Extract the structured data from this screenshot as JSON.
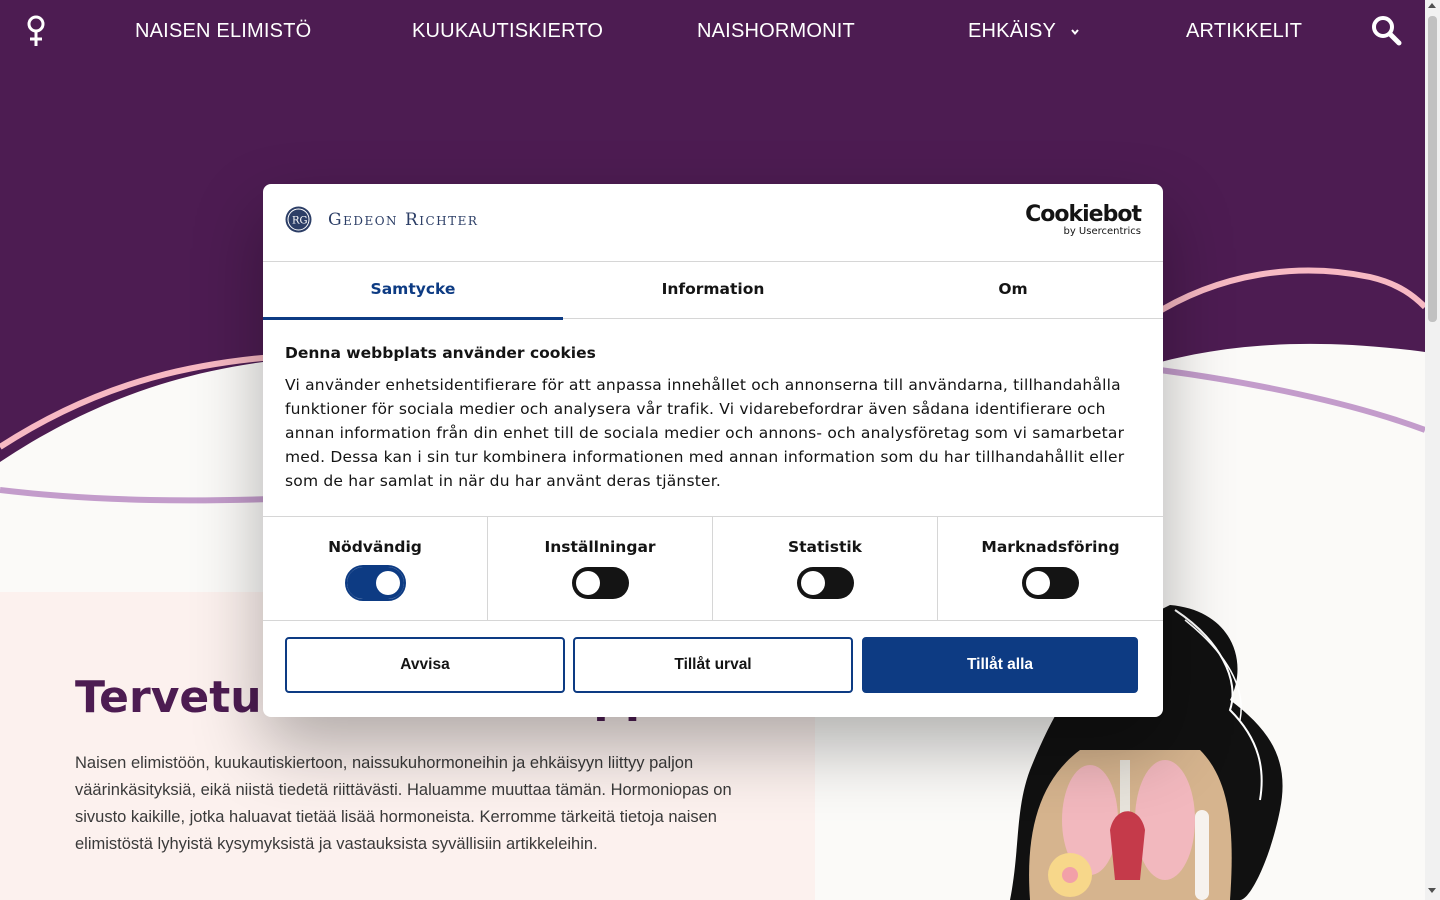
{
  "nav": {
    "items": [
      {
        "label": "NAISEN ELIMISTÖ"
      },
      {
        "label": "KUUKAUTISKIERTO"
      },
      {
        "label": "NAISHORMONIT"
      },
      {
        "label": "EHKÄISY"
      },
      {
        "label": "ARTIKKELIT"
      }
    ],
    "logo_icon": "female-symbol-icon",
    "search_icon": "search-icon"
  },
  "intro": {
    "title": "Tervetuloa Hormoniopp",
    "text": "Naisen elimistöön, kuukautiskiertoon, naissukuhormoneihin ja ehkäisyyn liittyy paljon väärinkäsityksiä, eikä niistä tiedetä riittävästi. Haluamme muuttaa tämän. Hormoniopas on sivusto kaikille, jotka haluavat tietää lisää hormoneista. Kerromme tärkeitä tietoja naisen elimistöstä lyhyistä kysymyksistä ja vastauksista syvällisiin artikkeleihin."
  },
  "cookie": {
    "brand": "Gedeon Richter",
    "cookiebot": {
      "name": "Cookiebot",
      "sub": "by Usercentrics"
    },
    "tabs": [
      "Samtycke",
      "Information",
      "Om"
    ],
    "heading": "Denna webbplats använder cookies",
    "description": "Vi använder enhetsidentifierare för att anpassa innehållet och annonserna till användarna, tillhandahålla funktioner för sociala medier och analysera vår trafik. Vi vidarebefordrar även sådana identifierare och annan information från din enhet till de sociala medier och annons- och analysföretag som vi samarbetar med. Dessa kan i sin tur kombinera informationen med annan information som du har tillhandahållit eller som de har samlat in när du har använt deras tjänster.",
    "toggles": [
      {
        "label": "Nödvändig",
        "on": true
      },
      {
        "label": "Inställningar",
        "on": false
      },
      {
        "label": "Statistik",
        "on": false
      },
      {
        "label": "Marknadsföring",
        "on": false
      }
    ],
    "buttons": {
      "reject": "Avvisa",
      "allow_selection": "Tillåt urval",
      "allow_all": "Tillåt alla"
    }
  },
  "colors": {
    "brand_purple": "#4d1c52",
    "pink_wave": "#f7b9c3",
    "lilac_wave": "#c39ccb",
    "dialog_blue": "#0d3b83"
  }
}
